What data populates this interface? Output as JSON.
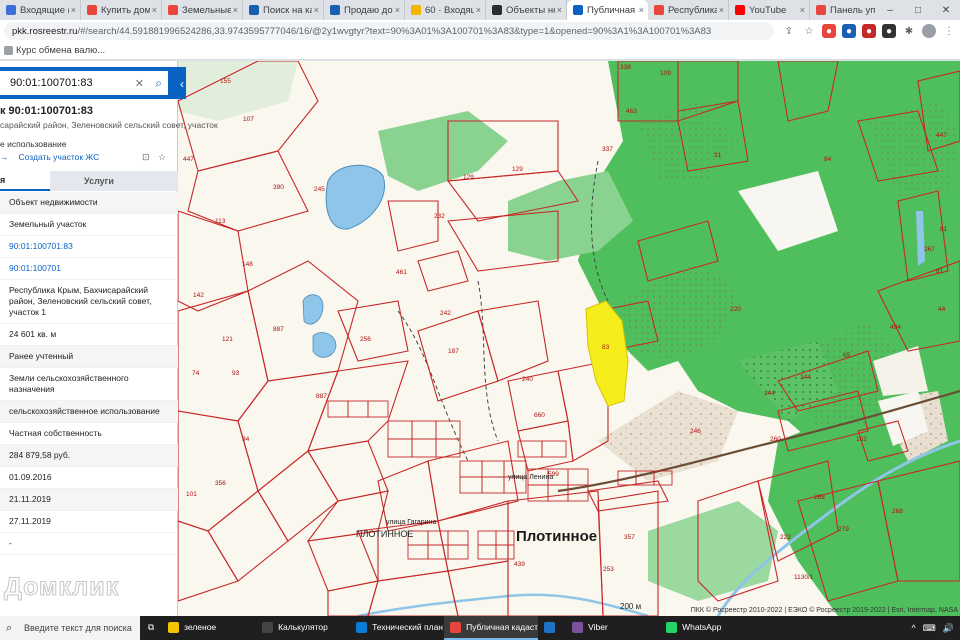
{
  "browser": {
    "tabs": [
      {
        "label": "Входящие (7…",
        "color": "#3a6fd8"
      },
      {
        "label": "Купить дом, у…",
        "color": "#e8453c"
      },
      {
        "label": "Земельные у…",
        "color": "#e8453c"
      },
      {
        "label": "Поиск на ка…",
        "color": "#1a5fb4"
      },
      {
        "label": "Продаю дом…",
        "color": "#1a5fb4"
      },
      {
        "label": "60 · Входящ…",
        "color": "#f4b400"
      },
      {
        "label": "Объекты нед…",
        "color": "#2d2d2d"
      },
      {
        "label": "Публичная к…",
        "color": "#0a62c2",
        "active": true
      },
      {
        "label": "Республика К…",
        "color": "#e8453c"
      },
      {
        "label": "YouTube",
        "color": "#ff0000"
      },
      {
        "label": "Панель упра…",
        "color": "#e8453c"
      }
    ],
    "new_tab": "+",
    "window_controls": [
      "–",
      "□",
      "✕"
    ],
    "address": {
      "host": "pkk.rosreestr.ru",
      "path": "/#/search/44.591881996524286,33.9743595777046/16/@2y1wvgtyr?text=90%3A01%3A100701%3A83&type=1&opened=90%3A1%3A100701%3A83"
    },
    "bookmark": "Курс обмена валю..."
  },
  "sidebar": {
    "search_value": "90:01:100701:83",
    "clear": "✕",
    "search_icon": "⌕",
    "collapse": "‹",
    "object_title": "к 90:01:100701:83",
    "object_address": "сарайский район, Зеленовский сельский совет, участок",
    "usage_heading": "е использование",
    "create_link": "Создать участок ЖС",
    "tabs": [
      "я",
      "Услуги"
    ],
    "rows": [
      {
        "text": "Объект недвижимости",
        "style": "grey"
      },
      {
        "text": "Земельный участок",
        "style": "plain"
      },
      {
        "text": "90:01:100701:83",
        "style": "link"
      },
      {
        "text": "90:01:100701",
        "style": "link"
      },
      {
        "text": "Республика Крым, Бахчисарайский район, Зеленовский сельский совет, участок 1",
        "style": "plain"
      },
      {
        "text": "24 601 кв. м",
        "style": "plain"
      },
      {
        "text": "Ранее учтенный",
        "style": "grey"
      },
      {
        "text": "Земли сельскохозяйственного назначения",
        "style": "plain"
      },
      {
        "text": "сельскохозяйственное использование",
        "style": "grey"
      },
      {
        "text": "Частная собственность",
        "style": "plain"
      },
      {
        "text": "284 879,58 руб.",
        "style": "grey"
      },
      {
        "text": "01.09.2016",
        "style": "plain"
      },
      {
        "text": "21.11.2019",
        "style": "grey"
      },
      {
        "text": "27.11.2019",
        "style": "plain"
      },
      {
        "text": "-",
        "style": "plain"
      }
    ],
    "watermark": "Домклик"
  },
  "map": {
    "place_name": "Плотинное",
    "place_small": "ПЛОТИННОЕ",
    "street_labels": [
      "улица Ленина",
      "улица Гагарина"
    ],
    "scale_label": "200 м",
    "attribution": "ПКК © Росреестр 2010-2022 | ЕЭКО © Росреестр 2019-2022 | Esri, Intermap, NASA",
    "parcel_numbers": [
      "155",
      "107",
      "390",
      "447",
      "113",
      "148",
      "142",
      "121",
      "74",
      "93",
      "94",
      "356",
      "101",
      "887",
      "245",
      "129",
      "232",
      "461",
      "242",
      "256",
      "187",
      "240",
      "660",
      "499",
      "599",
      "439",
      "357",
      "253",
      "338",
      "109",
      "337",
      "463",
      "447",
      "82",
      "267",
      "81",
      "494",
      "144",
      "102",
      "288",
      "222",
      "1130/1",
      "279",
      "268",
      "65",
      "21",
      "83",
      "220",
      "44",
      "246",
      "260",
      "84"
    ]
  },
  "taskbar": {
    "search_placeholder": "Введите текст для поиска",
    "items": [
      {
        "label": "зеленое",
        "color": "#f4c400"
      },
      {
        "label": "Калькулятор",
        "color": "#444"
      },
      {
        "label": "Технический план…",
        "color": "#0a7cd8"
      },
      {
        "label": "Публичная кадаст…",
        "color": "#e8453c",
        "active": true
      },
      {
        "label": "",
        "color": "#1e72c8"
      },
      {
        "label": "Viber",
        "color": "#7b519d"
      },
      {
        "label": "WhatsApp",
        "color": "#25d366"
      }
    ],
    "tray": [
      "^",
      "⌨",
      "🔊"
    ]
  }
}
